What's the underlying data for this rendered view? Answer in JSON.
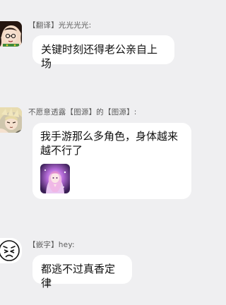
{
  "messages": [
    {
      "sender": "【翻译】光光光光:",
      "text": "关键时刻还得老公亲自上场",
      "avatar": "cartoon-girl-avatar"
    },
    {
      "sender": "不愿意透露【图源】的【图源】:",
      "text": "我手游那么多角色，身体越来越不行了",
      "avatar": "anime-boy-avatar",
      "sticker": "anime-character-sticker"
    },
    {
      "sender": "【嵌字】hey:",
      "text": "都逃不过真香定律",
      "avatar": "crying-face-avatar"
    }
  ],
  "colors": {
    "background": "#efeff1",
    "bubble": "#ffffff",
    "sender_text": "#5b5b5b",
    "message_text": "#111111"
  }
}
